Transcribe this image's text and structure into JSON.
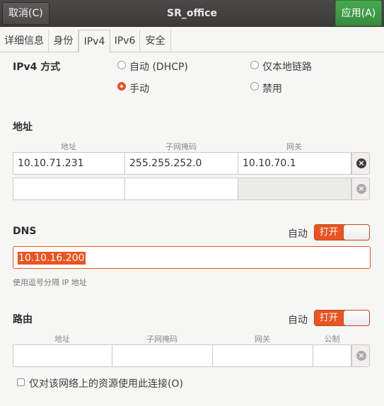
{
  "header": {
    "cancel_label": "取消(C)",
    "title": "SR_office",
    "apply_label": "应用(A)"
  },
  "tabs": [
    "详细信息",
    "身份",
    "IPv4",
    "IPv6",
    "安全"
  ],
  "ipv4": {
    "method_label": "IPv4 方式",
    "methods": {
      "auto": "自动 (DHCP)",
      "link_local": "仅本地链路",
      "manual": "手动",
      "disabled": "禁用"
    },
    "selected_method": "manual"
  },
  "address": {
    "section_label": "地址",
    "columns": [
      "地址",
      "子网掩码",
      "网关"
    ],
    "rows": [
      [
        "10.10.71.231",
        "255.255.252.0",
        "10.10.70.1"
      ],
      [
        "",
        "",
        ""
      ]
    ]
  },
  "dns": {
    "section_label": "DNS",
    "auto_label": "自动",
    "switch_label": "打开",
    "value": "10.10.16.200",
    "hint": "使用逗号分隔 IP 地址"
  },
  "routes": {
    "section_label": "路由",
    "auto_label": "自动",
    "switch_label": "打开",
    "columns": [
      "地址",
      "子网掩码",
      "网关",
      "公制"
    ]
  },
  "only_local_label": "仅对该网络上的资源使用此连接(O)"
}
